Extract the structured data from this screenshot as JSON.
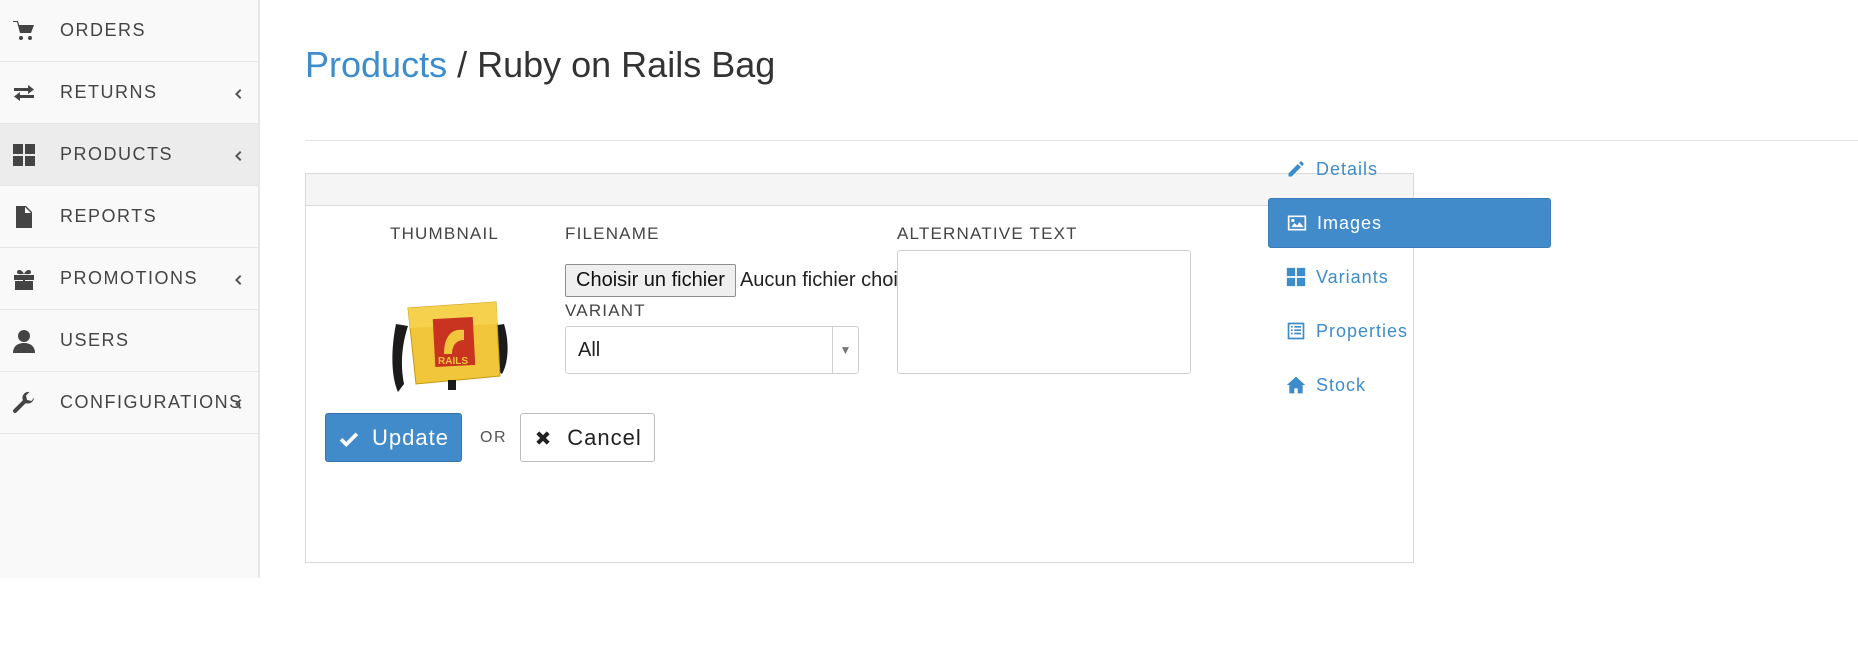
{
  "sidebar": {
    "items": [
      {
        "label": "ORDERS",
        "icon": "cart-icon",
        "has_caret": false,
        "active": false
      },
      {
        "label": "RETURNS",
        "icon": "exchange-icon",
        "has_caret": true,
        "active": false
      },
      {
        "label": "PRODUCTS",
        "icon": "grid-icon",
        "has_caret": true,
        "active": true
      },
      {
        "label": "REPORTS",
        "icon": "file-icon",
        "has_caret": false,
        "active": false
      },
      {
        "label": "PROMOTIONS",
        "icon": "gift-icon",
        "has_caret": true,
        "active": false
      },
      {
        "label": "USERS",
        "icon": "user-icon",
        "has_caret": false,
        "active": false
      },
      {
        "label": "CONFIGURATIONS",
        "icon": "wrench-icon",
        "has_caret": true,
        "active": false
      }
    ]
  },
  "header": {
    "breadcrumb_link": "Products",
    "separator": " / ",
    "title": "Ruby on Rails Bag"
  },
  "form": {
    "thumbnail_label": "THUMBNAIL",
    "filename_label": "FILENAME",
    "file_button": "Choisir un fichier",
    "file_status": "Aucun fichier choisi",
    "variant_label": "VARIANT",
    "variant_value": "All",
    "alt_text_label": "ALTERNATIVE TEXT",
    "alt_text_value": "",
    "update_button": "Update",
    "or_text": "OR",
    "cancel_button": "Cancel"
  },
  "tabs": [
    {
      "label": "Details",
      "icon": "pencil-icon",
      "active": false
    },
    {
      "label": "Images",
      "icon": "picture-icon",
      "active": true
    },
    {
      "label": "Variants",
      "icon": "grid-icon",
      "active": false
    },
    {
      "label": "Properties",
      "icon": "list-icon",
      "active": false
    },
    {
      "label": "Stock",
      "icon": "home-icon",
      "active": false
    }
  ],
  "colors": {
    "accent": "#428bca",
    "link": "#3d8dcc",
    "sidebar_bg": "#f9f9f9",
    "sidebar_active": "#ececec"
  }
}
